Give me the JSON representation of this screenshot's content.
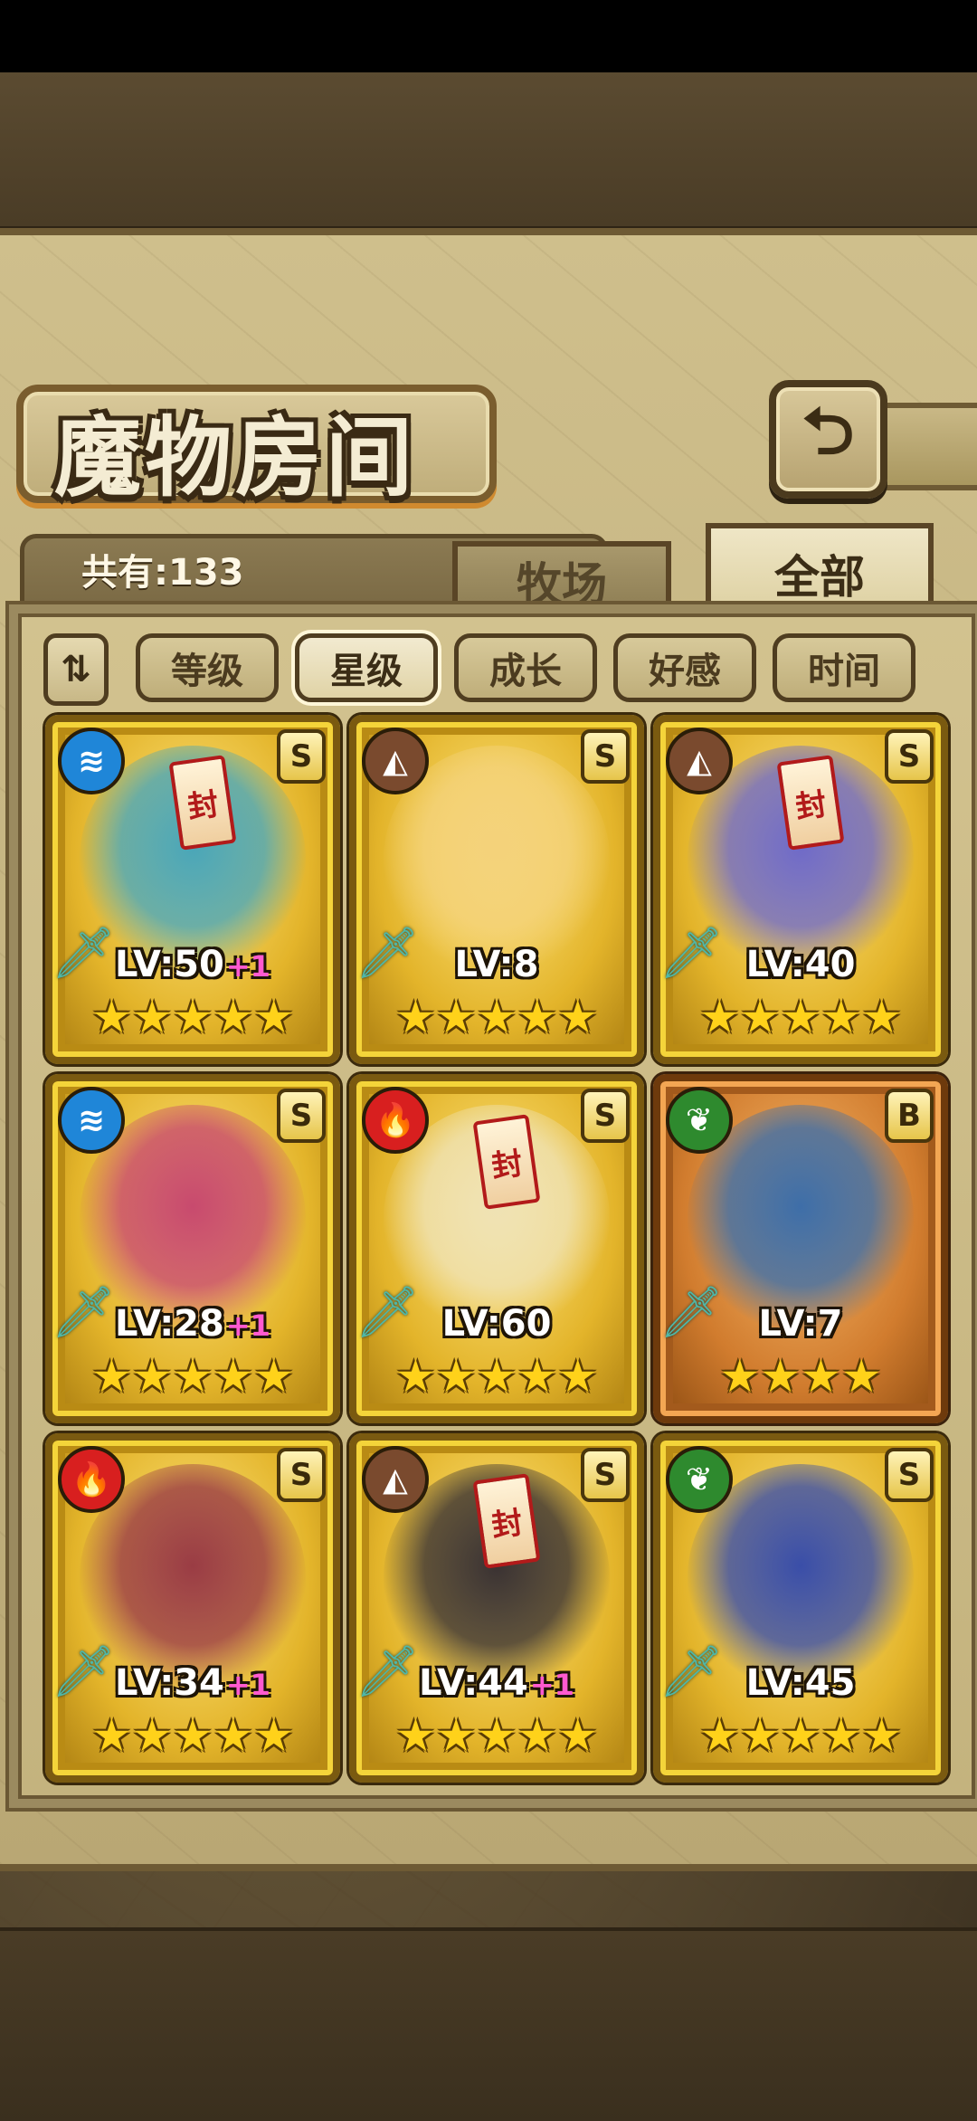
{
  "header": {
    "title": "魔物房间",
    "back_icon": "return-arrow-icon"
  },
  "summary": {
    "count_label": "共有:133"
  },
  "tabs": [
    {
      "label": "牧场",
      "active": false
    },
    {
      "label": "全部",
      "active": true
    }
  ],
  "sort": {
    "toggle_icon": "sort-order-icon",
    "options": [
      {
        "label": "等级",
        "selected": false
      },
      {
        "label": "星级",
        "selected": true
      },
      {
        "label": "成长",
        "selected": false
      },
      {
        "label": "好感",
        "selected": false
      },
      {
        "label": "时间",
        "selected": false
      }
    ]
  },
  "monsters": [
    {
      "element": "water",
      "rank": "S",
      "lv": "LV:50",
      "bonus": "+1",
      "stars": "★★★★★",
      "frame": "gold",
      "sealed": true,
      "portrait_color": "#4aa6b8"
    },
    {
      "element": "earth",
      "rank": "S",
      "lv": "LV:8",
      "bonus": "",
      "stars": "★★★★★",
      "frame": "gold",
      "sealed": false,
      "portrait_color": "#f4d27a"
    },
    {
      "element": "earth",
      "rank": "S",
      "lv": "LV:40",
      "bonus": "",
      "stars": "★★★★★",
      "frame": "gold",
      "sealed": true,
      "portrait_color": "#6f6ac8"
    },
    {
      "element": "water",
      "rank": "S",
      "lv": "LV:28",
      "bonus": "+1",
      "stars": "★★★★★",
      "frame": "gold",
      "sealed": false,
      "portrait_color": "#c84a6e"
    },
    {
      "element": "fire",
      "rank": "S",
      "lv": "LV:60",
      "bonus": "",
      "stars": "★★★★★",
      "frame": "gold",
      "sealed": true,
      "portrait_color": "#efe2b4"
    },
    {
      "element": "wind",
      "rank": "B",
      "lv": "LV:7",
      "bonus": "",
      "stars": "★★★★",
      "frame": "bronze",
      "sealed": false,
      "portrait_color": "#3e6ea8"
    },
    {
      "element": "fire",
      "rank": "S",
      "lv": "LV:34",
      "bonus": "+1",
      "stars": "★★★★★",
      "frame": "gold",
      "sealed": false,
      "portrait_color": "#9a3c44"
    },
    {
      "element": "earth",
      "rank": "S",
      "lv": "LV:44",
      "bonus": "+1",
      "stars": "★★★★★",
      "frame": "gold",
      "sealed": true,
      "portrait_color": "#3a3232"
    },
    {
      "element": "wind",
      "rank": "S",
      "lv": "LV:45",
      "bonus": "",
      "stars": "★★★★★",
      "frame": "gold",
      "sealed": false,
      "portrait_color": "#3a4ea8"
    }
  ],
  "element_icons": {
    "water": "water-waves-icon",
    "earth": "mountain-icon",
    "fire": "flame-icon",
    "wind": "leaf-icon"
  },
  "seal_text": "封"
}
